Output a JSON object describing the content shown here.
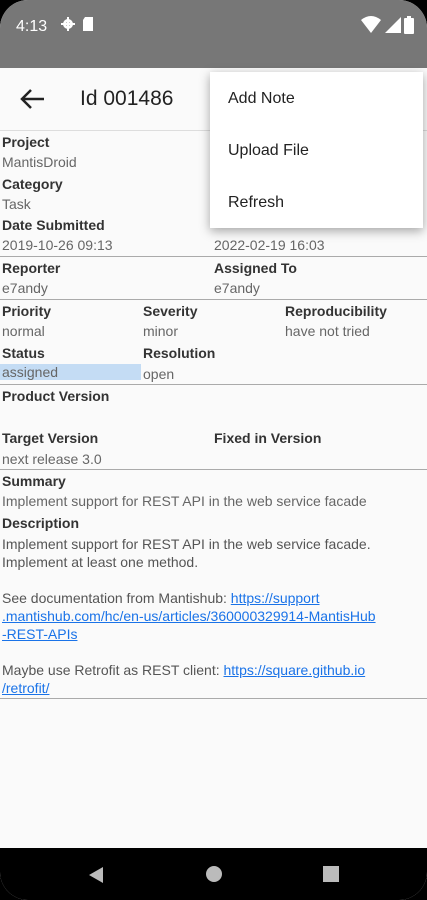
{
  "status": {
    "time": "4:13"
  },
  "appbar": {
    "title": "Id 001486"
  },
  "menu": {
    "items": [
      "Add Note",
      "Upload File",
      "Refresh"
    ]
  },
  "fields": {
    "project_label": "Project",
    "project_value": "MantisDroid",
    "category_label": "Category",
    "category_value": "Task",
    "date_submitted_label": "Date Submitted",
    "date_submitted_value": "2019-10-26 09:13",
    "last_update_value": "2022-02-19 16:03",
    "reporter_label": "Reporter",
    "reporter_value": "e7andy",
    "assigned_label": "Assigned To",
    "assigned_value": "e7andy",
    "priority_label": "Priority",
    "priority_value": "normal",
    "severity_label": "Severity",
    "severity_value": "minor",
    "repro_label": "Reproducibility",
    "repro_value": "have not tried",
    "status_label": "Status",
    "status_value": "assigned",
    "resolution_label": "Resolution",
    "resolution_value": "open",
    "product_version_label": "Product Version",
    "target_version_label": "Target Version",
    "target_version_value": "next release 3.0",
    "fixed_version_label": "Fixed in Version",
    "summary_label": "Summary",
    "summary_value": "Implement support for REST API in the web service facade",
    "description_label": "Description",
    "description_line1": "Implement support for REST API in the web service facade.",
    "description_line2": "Implement at least one method.",
    "doc_text": "See documentation from Mantishub: ",
    "doc_link_a": "https://support",
    "doc_link_b": ".mantishub.com/hc/en-us/articles/360000329914-MantisHub",
    "doc_link_c": "-REST-APIs",
    "retrofit_text": "Maybe use Retrofit as REST client: ",
    "retrofit_link_a": "https://square.github.io",
    "retrofit_link_b": "/retrofit/"
  },
  "colors": {
    "status_highlight": "#c4dcf4",
    "link": "#1a73e8"
  }
}
